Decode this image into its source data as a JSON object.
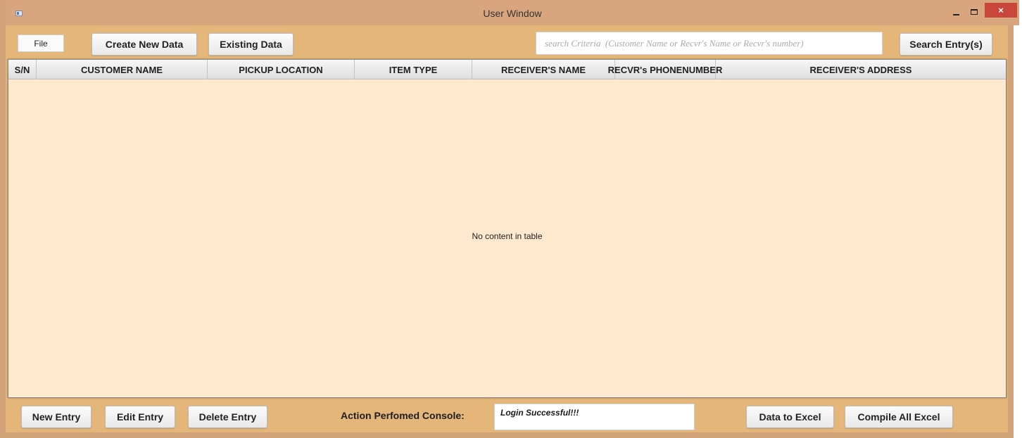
{
  "window": {
    "title": "User Window",
    "close_glyph": "×"
  },
  "toolbar": {
    "file_menu": "File",
    "create_new_data": "Create New Data",
    "existing_data": "Existing Data",
    "search_placeholder": "search Criteria  (Customer Name or Recvr's Name or Recvr's number)",
    "search_button": "Search Entry(s)"
  },
  "table": {
    "columns": [
      "S/N",
      "CUSTOMER NAME",
      "PICKUP LOCATION",
      "ITEM TYPE",
      "RECEIVER'S NAME",
      "RECVR's PHONENUMBER",
      "RECEIVER'S ADDRESS"
    ],
    "rows": [],
    "empty_message": "No content in table"
  },
  "footer": {
    "new_entry": "New Entry",
    "edit_entry": "Edit Entry",
    "delete_entry": "Delete Entry",
    "console_label": "Action Perfomed Console:",
    "console_text": "Login Successful!!!",
    "data_to_excel": "Data to Excel",
    "compile_all_excel": "Compile All Excel"
  },
  "colors": {
    "window_bg": "#e4b67a",
    "titlebar_bg": "#d9a57e",
    "table_bg": "#fee9cf",
    "close_button": "#c9463d"
  }
}
